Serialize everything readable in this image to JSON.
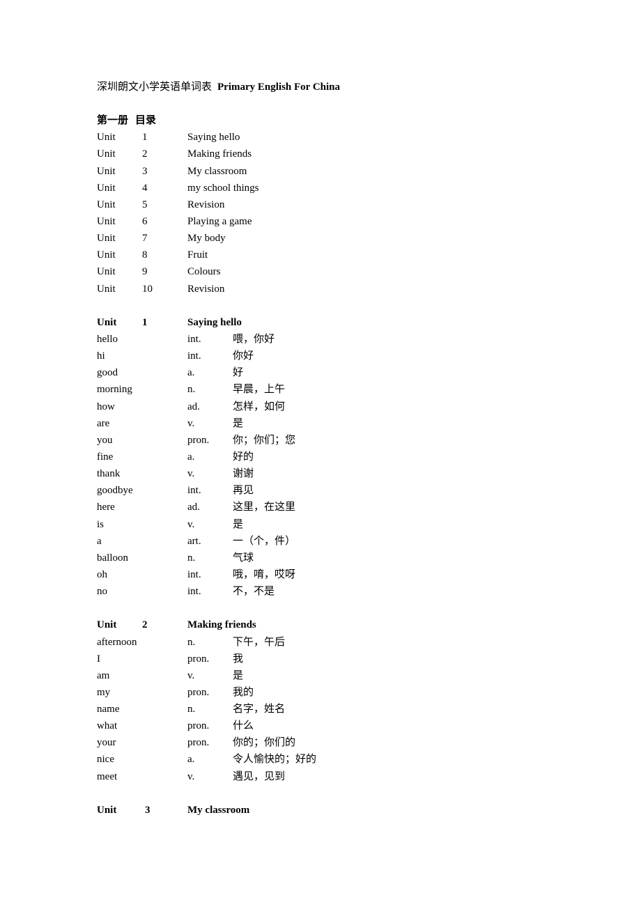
{
  "document": {
    "title_cn": "深圳朗文小学英语单词表",
    "title_en": "Primary English For China",
    "toc": {
      "heading_cn": "第一册",
      "heading_sub": "目录",
      "units": [
        {
          "label": "Unit",
          "num": "1",
          "name": "Saying hello"
        },
        {
          "label": "Unit",
          "num": "2",
          "name": "Making friends"
        },
        {
          "label": "Unit",
          "num": "3",
          "name": "My classroom"
        },
        {
          "label": "Unit",
          "num": "4",
          "name": "my school things"
        },
        {
          "label": "Unit",
          "num": "5",
          "name": "Revision"
        },
        {
          "label": "Unit",
          "num": "6",
          "name": "Playing a game"
        },
        {
          "label": "Unit",
          "num": "7",
          "name": "My body"
        },
        {
          "label": "Unit",
          "num": "8",
          "name": "Fruit"
        },
        {
          "label": "Unit",
          "num": "9",
          "name": "Colours"
        },
        {
          "label": "Unit",
          "num": "10",
          "name": "Revision"
        }
      ]
    },
    "sections": [
      {
        "label": "Unit",
        "num": "1",
        "name": "Saying hello",
        "words": [
          {
            "word": "hello",
            "pos": "int.",
            "meaning": "喂，你好"
          },
          {
            "word": "hi",
            "pos": "int.",
            "meaning": "你好"
          },
          {
            "word": "good",
            "pos": "a.",
            "meaning": "好"
          },
          {
            "word": "morning",
            "pos": "n.",
            "meaning": "早晨，上午"
          },
          {
            "word": "how",
            "pos": "ad.",
            "meaning": "怎样，如何"
          },
          {
            "word": "are",
            "pos": "v.",
            "meaning": "是"
          },
          {
            "word": "you",
            "pos": "pron.",
            "meaning": "你；你们；您"
          },
          {
            "word": "fine",
            "pos": "a.",
            "meaning": "好的"
          },
          {
            "word": "thank",
            "pos": "v.",
            "meaning": "谢谢"
          },
          {
            "word": "goodbye",
            "pos": "int.",
            "meaning": "再见"
          },
          {
            "word": "here",
            "pos": "ad.",
            "meaning": "这里，在这里"
          },
          {
            "word": "is",
            "pos": "v.",
            "meaning": "是"
          },
          {
            "word": "a",
            "pos": "art.",
            "meaning": "一（个，件）"
          },
          {
            "word": "balloon",
            "pos": "n.",
            "meaning": "气球"
          },
          {
            "word": "oh",
            "pos": "int.",
            "meaning": "哦，唷，哎呀"
          },
          {
            "word": "no",
            "pos": "int.",
            "meaning": "不，不是"
          }
        ]
      },
      {
        "label": "Unit",
        "num": "2",
        "name": "Making friends",
        "words": [
          {
            "word": "afternoon",
            "pos": "n.",
            "meaning": "下午，午后"
          },
          {
            "word": "I",
            "pos": "pron.",
            "meaning": "我"
          },
          {
            "word": "am",
            "pos": "v.",
            "meaning": "是"
          },
          {
            "word": "my",
            "pos": "pron.",
            "meaning": "我的"
          },
          {
            "word": "name",
            "pos": "n.",
            "meaning": "名字，姓名"
          },
          {
            "word": "what",
            "pos": "pron.",
            "meaning": "什么"
          },
          {
            "word": "your",
            "pos": "pron.",
            "meaning": "你的；你们的"
          },
          {
            "word": "nice",
            "pos": "a.",
            "meaning": "令人愉快的；好的"
          },
          {
            "word": "meet",
            "pos": "v.",
            "meaning": "遇见，见到"
          }
        ]
      },
      {
        "label": "Unit",
        "num": "3",
        "name": "My classroom",
        "words": []
      }
    ]
  }
}
